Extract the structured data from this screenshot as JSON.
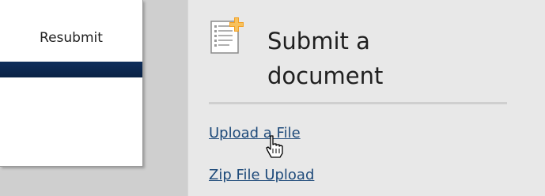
{
  "left_panel": {
    "tab_label": "Resubmit"
  },
  "right_panel": {
    "icon": "document-add-icon",
    "title_line1": "Submit a",
    "title_line2": "document",
    "links": [
      {
        "label": "Upload a File"
      },
      {
        "label": "Zip File Upload"
      }
    ]
  },
  "colors": {
    "navy": "#0f2f5c",
    "link": "#1e4a7a",
    "panel": "#e8e8e8"
  },
  "cursor": "hand-pointer-icon"
}
